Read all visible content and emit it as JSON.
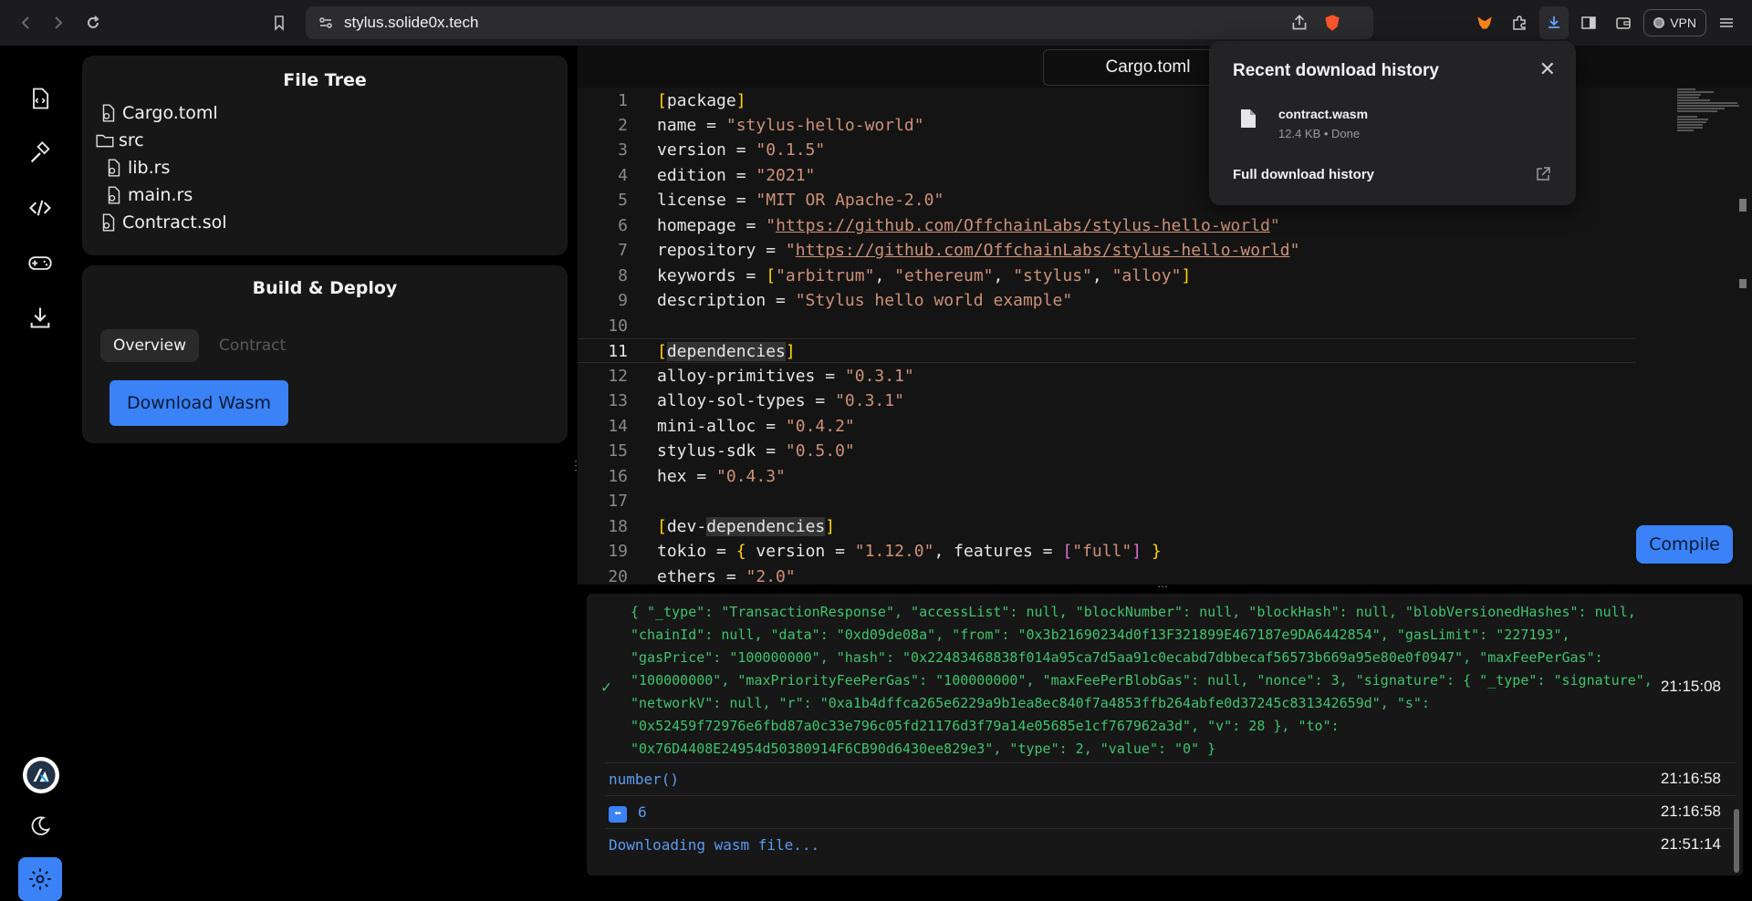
{
  "browser": {
    "url": "stylus.solide0x.tech",
    "vpn_label": "VPN"
  },
  "file_tree": {
    "title": "File Tree",
    "items": [
      {
        "name": "Cargo.toml",
        "type": "file"
      },
      {
        "name": "src",
        "type": "folder"
      },
      {
        "name": "lib.rs",
        "type": "file"
      },
      {
        "name": "main.rs",
        "type": "file"
      },
      {
        "name": "Contract.sol",
        "type": "file"
      }
    ]
  },
  "build": {
    "title": "Build & Deploy",
    "tabs": [
      "Overview",
      "Contract"
    ],
    "download_label": "Download Wasm"
  },
  "editor": {
    "tab_label": "Cargo.toml",
    "compile_label": "Compile",
    "lines": [
      {
        "n": "1",
        "text": "[package]"
      },
      {
        "n": "2",
        "text": "name = \"stylus-hello-world\""
      },
      {
        "n": "3",
        "text": "version = \"0.1.5\""
      },
      {
        "n": "4",
        "text": "edition = \"2021\""
      },
      {
        "n": "5",
        "text": "license = \"MIT OR Apache-2.0\""
      },
      {
        "n": "6",
        "text": "homepage = \"https://github.com/OffchainLabs/stylus-hello-world\""
      },
      {
        "n": "7",
        "text": "repository = \"https://github.com/OffchainLabs/stylus-hello-world\""
      },
      {
        "n": "8",
        "text": "keywords = [\"arbitrum\", \"ethereum\", \"stylus\", \"alloy\"]"
      },
      {
        "n": "9",
        "text": "description = \"Stylus hello world example\""
      },
      {
        "n": "10",
        "text": ""
      },
      {
        "n": "11",
        "text": "[dependencies]"
      },
      {
        "n": "12",
        "text": "alloy-primitives = \"0.3.1\""
      },
      {
        "n": "13",
        "text": "alloy-sol-types = \"0.3.1\""
      },
      {
        "n": "14",
        "text": "mini-alloc = \"0.4.2\""
      },
      {
        "n": "15",
        "text": "stylus-sdk = \"0.5.0\""
      },
      {
        "n": "16",
        "text": "hex = \"0.4.3\""
      },
      {
        "n": "17",
        "text": ""
      },
      {
        "n": "18",
        "text": "[dev-dependencies]"
      },
      {
        "n": "19",
        "text": "tokio = { version = \"1.12.0\", features = [\"full\"] }"
      },
      {
        "n": "20",
        "text": "ethers = \"2.0\""
      }
    ]
  },
  "console": {
    "tx_log": "{ \"_type\": \"TransactionResponse\", \"accessList\": null, \"blockNumber\": null, \"blockHash\": null, \"blobVersionedHashes\": null, \"chainId\": null, \"data\": \"0xd09de08a\", \"from\": \"0x3b21690234d0f13F321899E467187e9DA6442854\", \"gasLimit\": \"227193\", \"gasPrice\": \"100000000\", \"hash\": \"0x22483468838f014a95ca7d5aa91c0ecabd7dbbecaf56573b669a95e80e0f0947\", \"maxFeePerGas\": \"100000000\", \"maxPriorityFeePerGas\": \"100000000\", \"maxFeePerBlobGas\": null, \"nonce\": 3, \"signature\": { \"_type\": \"signature\", \"networkV\": null, \"r\": \"0xa1b4dffca265e6229a9b1ea8ec840f7a4853ffb264abfe0d37245c831342659d\", \"s\": \"0x52459f72976e6fbd87a0c33e796c05fd21176d3f79a14e05685e1cf767962a3d\", \"v\": 28 }, \"to\": \"0x76D4408E24954d50380914F6CB90d6430ee829e3\", \"type\": 2, \"value\": \"0\" }",
    "tx_time": "21:15:08",
    "call_label": "number()",
    "call_time": "21:16:58",
    "result_value": "6",
    "result_time": "21:16:58",
    "download_msg": "Downloading wasm file...",
    "download_time": "21:51:14"
  },
  "download_popup": {
    "title": "Recent download history",
    "file_name": "contract.wasm",
    "file_meta": "12.4 KB • Done",
    "full_history_label": "Full download history"
  }
}
